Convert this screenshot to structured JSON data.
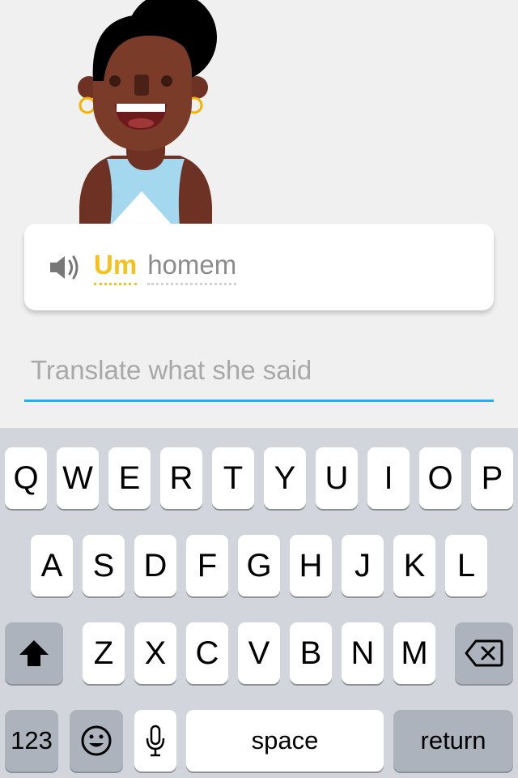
{
  "prompt_card": {
    "speaker_icon": "speaker-icon",
    "words": [
      {
        "text": "Um",
        "status": "new"
      },
      {
        "text": "homem",
        "status": "known"
      }
    ]
  },
  "answer": {
    "placeholder": "Translate what she said",
    "value": ""
  },
  "keyboard": {
    "row1": [
      "Q",
      "W",
      "E",
      "R",
      "T",
      "Y",
      "U",
      "I",
      "O",
      "P"
    ],
    "row2": [
      "A",
      "S",
      "D",
      "F",
      "G",
      "H",
      "J",
      "K",
      "L"
    ],
    "row3": [
      "Z",
      "X",
      "C",
      "V",
      "B",
      "N",
      "M"
    ],
    "shift_icon": "shift-arrow-icon",
    "backspace_icon": "backspace-icon",
    "numbers_label": "123",
    "emoji_icon": "emoji-icon",
    "mic_icon": "microphone-icon",
    "space_label": "space",
    "return_label": "return"
  },
  "colors": {
    "accent_yellow": "#f5c21b",
    "input_underline": "#1cb0f6",
    "keyboard_bg": "#d3d5dd"
  }
}
